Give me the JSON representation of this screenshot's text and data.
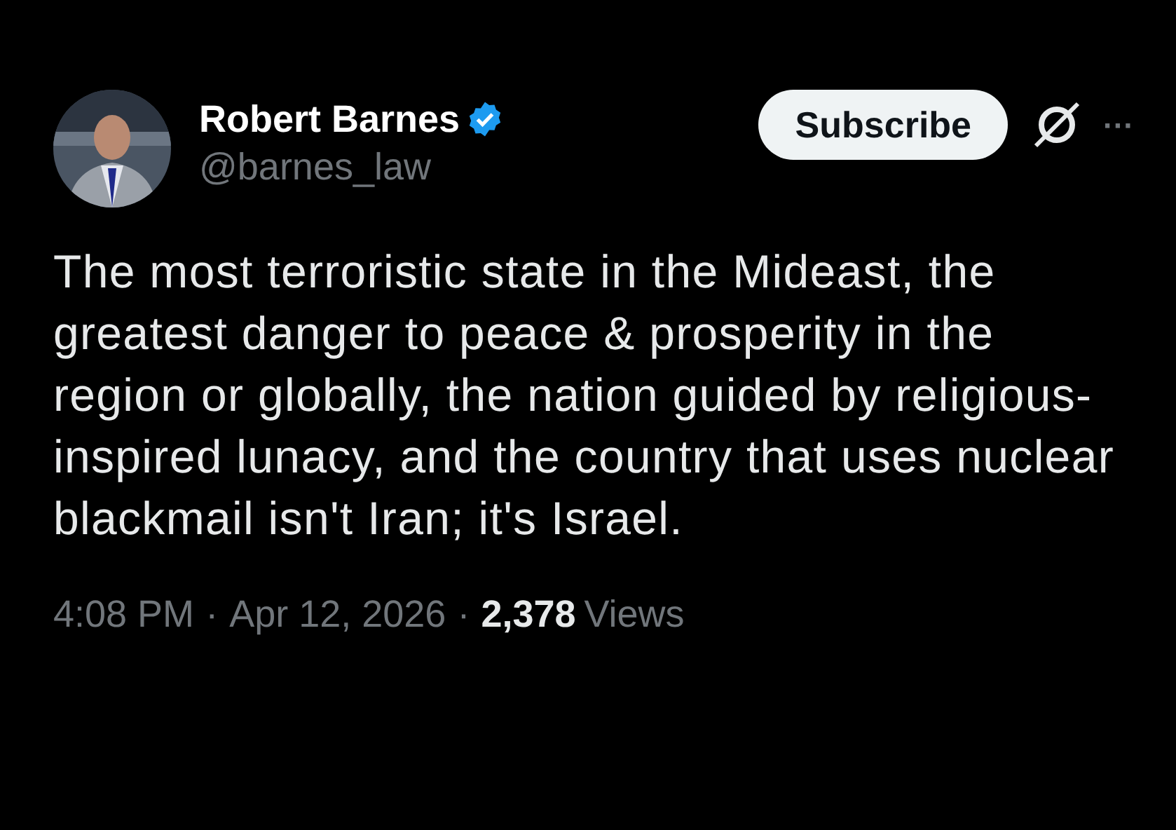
{
  "author": {
    "name": "Robert Barnes",
    "verified": true,
    "handle": "@barnes_law"
  },
  "actions": {
    "subscribe": "Subscribe",
    "more": "···"
  },
  "text": "The most terroristic state in the Mideast, the greatest danger to peace & prosperity in the region or globally, the nation guided by religious-inspired lunacy, and the country that uses nuclear blackmail isn't Iran; it's Israel.",
  "meta": {
    "time": "4:08 PM",
    "separator": "·",
    "date": "Apr 12, 2026",
    "separator_2": "·",
    "views_count": "2,378",
    "views_label": "Views"
  }
}
